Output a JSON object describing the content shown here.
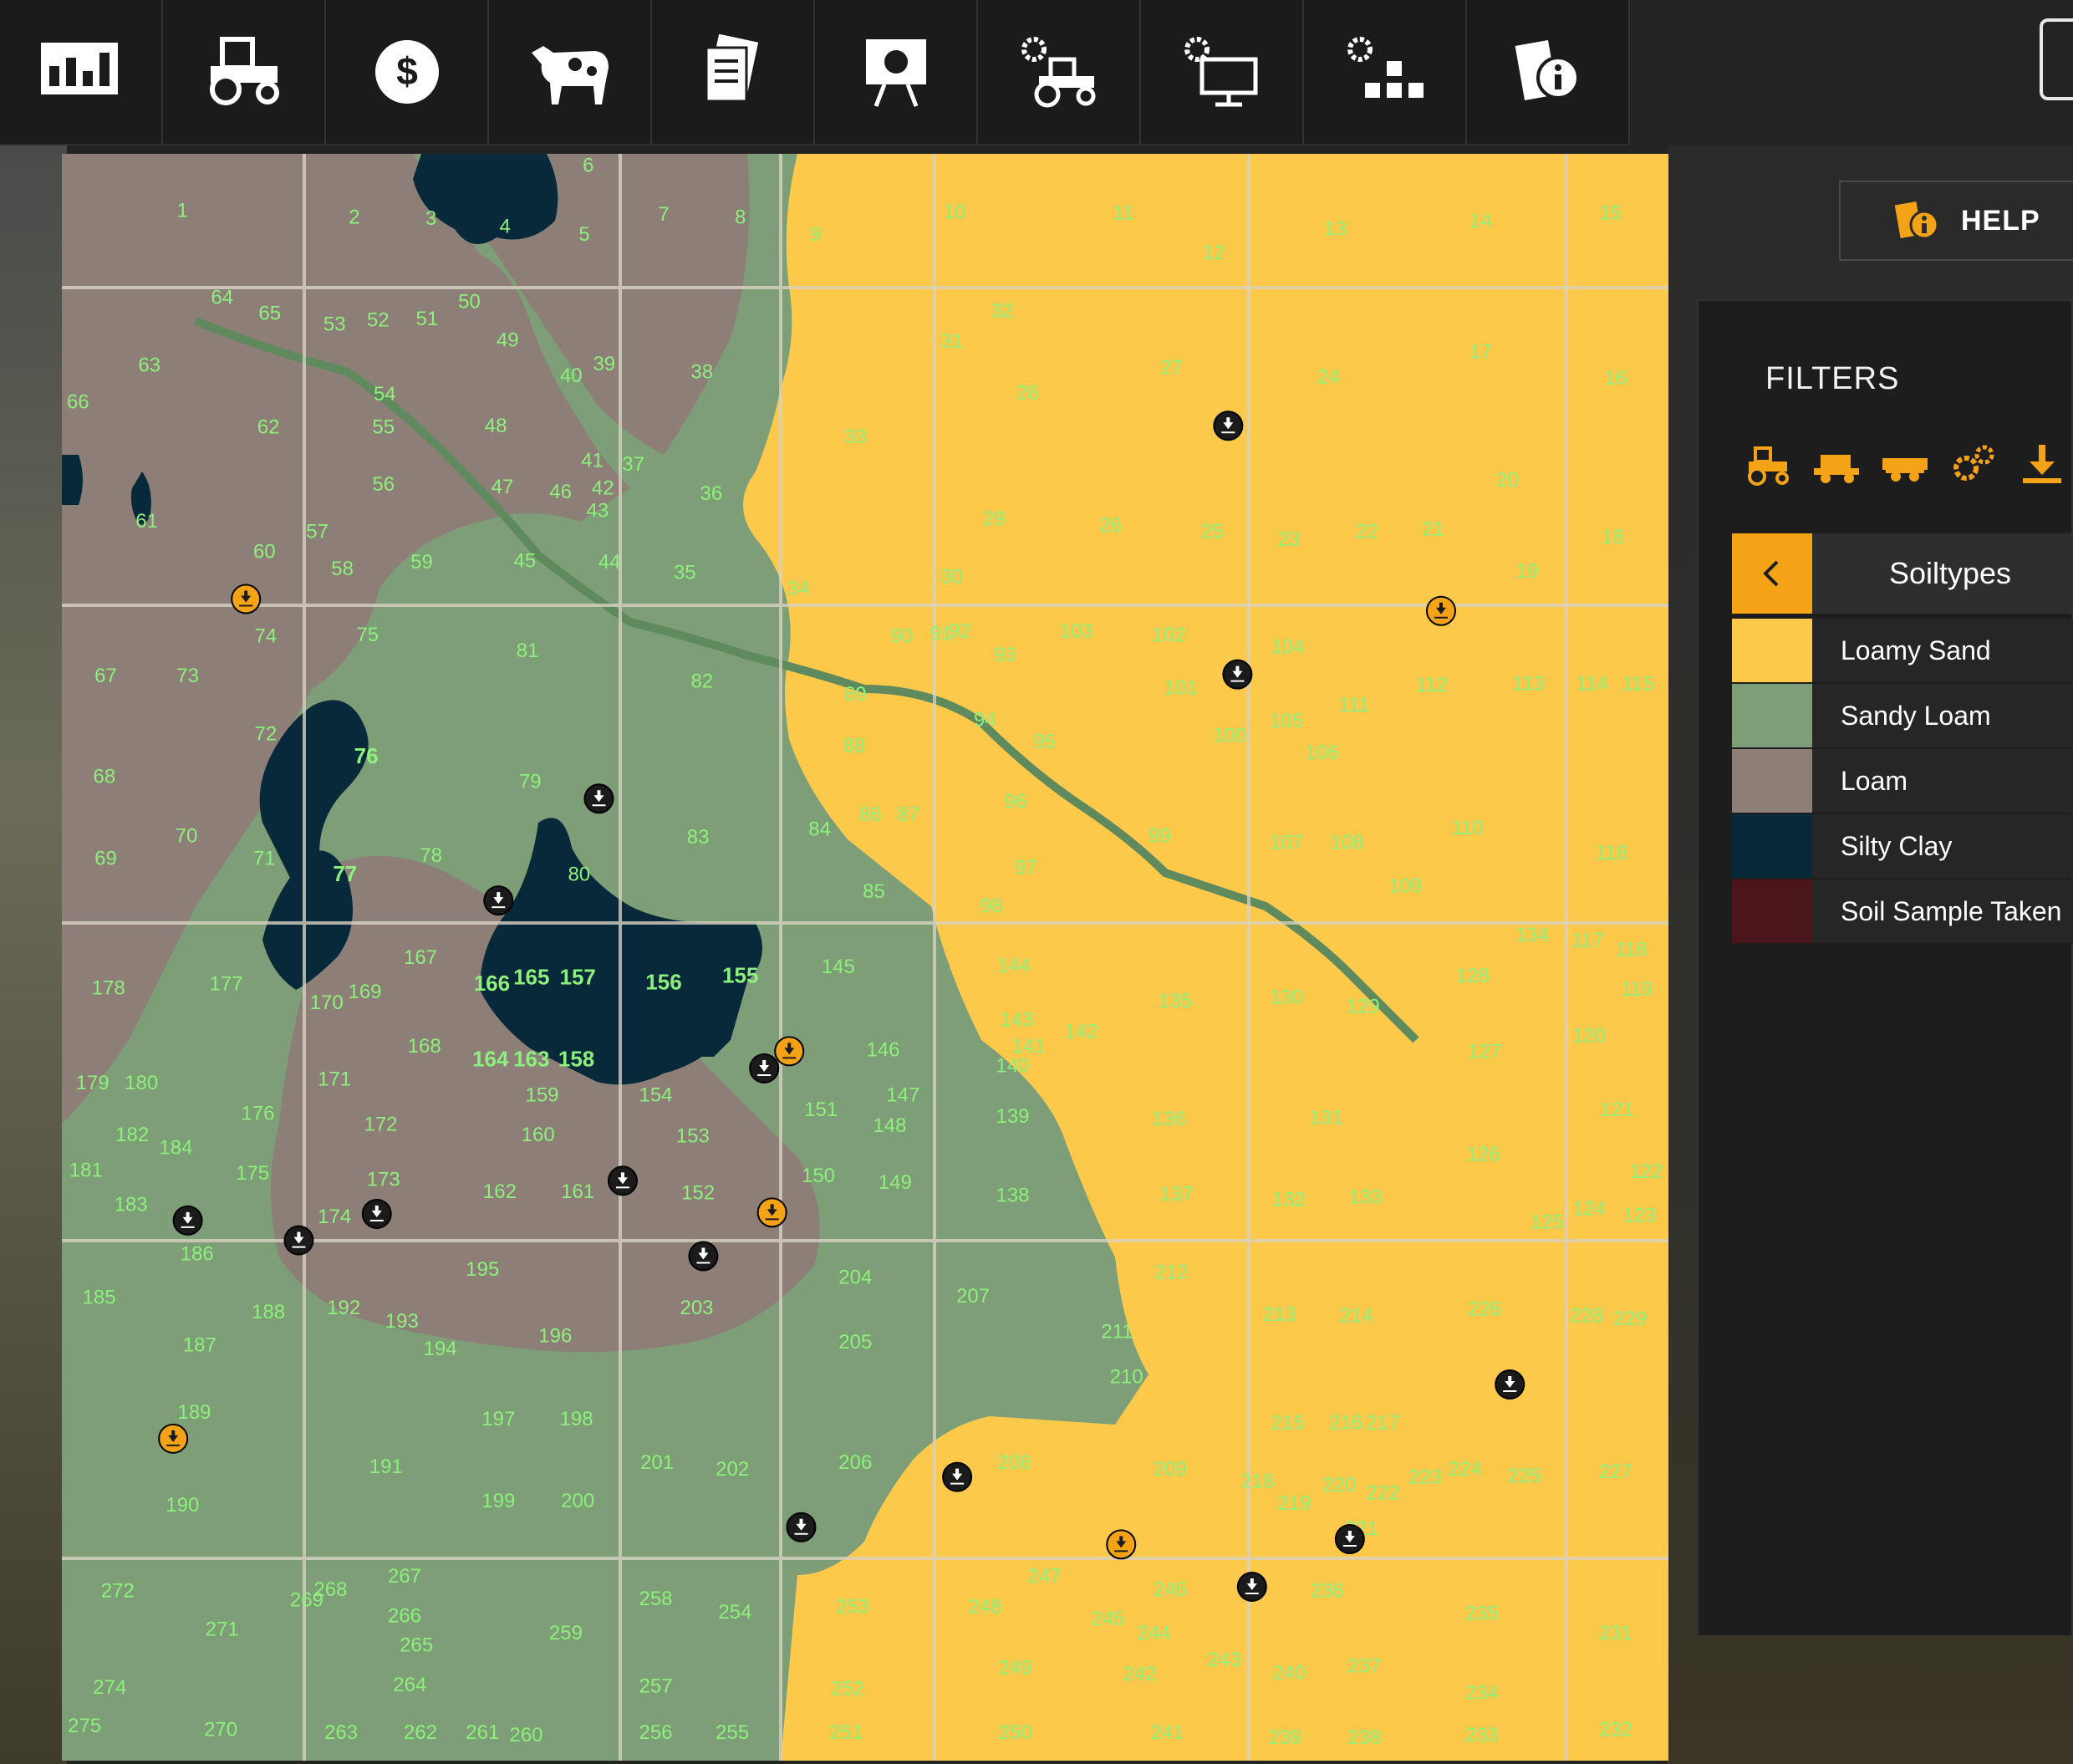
{
  "toolbar": {
    "tools": [
      {
        "icon": "stats-icon"
      },
      {
        "icon": "tractor-icon"
      },
      {
        "icon": "dollar-icon"
      },
      {
        "icon": "cow-icon"
      },
      {
        "icon": "contracts-icon"
      },
      {
        "icon": "presentation-icon"
      },
      {
        "icon": "vehicle-settings-icon"
      },
      {
        "icon": "monitor-settings-icon"
      },
      {
        "icon": "production-settings-icon"
      },
      {
        "icon": "info-icon"
      }
    ]
  },
  "help_button": {
    "label": "HELP",
    "icon": "help-icon"
  },
  "filters": {
    "title": "FILTERS",
    "icons": [
      "tractor-filter-icon",
      "harvester-filter-icon",
      "trailer-filter-icon",
      "gears-filter-icon",
      "unload-filter-icon"
    ],
    "accent": "#f5a316"
  },
  "soiltypes": {
    "title": "Soiltypes",
    "items": [
      {
        "label": "Loamy Sand",
        "color": "#fdc94b"
      },
      {
        "label": "Sandy Loam",
        "color": "#7d9e76"
      },
      {
        "label": "Loam",
        "color": "#8d7f78"
      },
      {
        "label": "Silty Clay",
        "color": "#072939"
      },
      {
        "label": "Soil Sample Taken",
        "color": "#4b151c"
      }
    ]
  },
  "field_labels": [
    "1",
    "2",
    "3",
    "4",
    "5",
    "6",
    "7",
    "8",
    "9",
    "10",
    "11",
    "12",
    "13",
    "14",
    "15",
    "16",
    "17",
    "18",
    "19",
    "20",
    "21",
    "22",
    "23",
    "24",
    "25",
    "26",
    "27",
    "28",
    "29",
    "30",
    "31",
    "32",
    "33",
    "34",
    "35",
    "36",
    "37",
    "38",
    "39",
    "40",
    "41",
    "42",
    "43",
    "44",
    "45",
    "46",
    "47",
    "48",
    "49",
    "50",
    "51",
    "52",
    "53",
    "54",
    "55",
    "56",
    "57",
    "58",
    "59",
    "60",
    "61",
    "62",
    "63",
    "64",
    "65",
    "66",
    "67",
    "68",
    "69",
    "70",
    "71",
    "72",
    "73",
    "74",
    "75",
    "76",
    "77",
    "78",
    "79",
    "80",
    "81",
    "82",
    "83",
    "84",
    "85",
    "86",
    "87",
    "88",
    "89",
    "90",
    "91",
    "92",
    "93",
    "94",
    "95",
    "96",
    "97",
    "98",
    "99",
    "100",
    "101",
    "102",
    "103",
    "104",
    "105",
    "106",
    "107",
    "108",
    "109",
    "110",
    "111",
    "112",
    "113",
    "114",
    "115",
    "116",
    "117",
    "118",
    "119",
    "120",
    "121",
    "122",
    "123",
    "124",
    "125",
    "126",
    "127",
    "128",
    "129",
    "130",
    "131",
    "132",
    "133",
    "134",
    "135",
    "136",
    "137",
    "138",
    "139",
    "140",
    "141",
    "142",
    "143",
    "144",
    "145",
    "146",
    "147",
    "148",
    "149",
    "150",
    "151",
    "152",
    "153",
    "154",
    "155",
    "156",
    "157",
    "158",
    "159",
    "160",
    "161",
    "162",
    "163",
    "164",
    "165",
    "166",
    "167",
    "168",
    "169",
    "170",
    "171",
    "172",
    "173",
    "174",
    "175",
    "176",
    "177",
    "178",
    "179",
    "180",
    "181",
    "182",
    "183",
    "184",
    "185",
    "186",
    "187",
    "188",
    "189",
    "190",
    "191",
    "192",
    "193",
    "194",
    "195",
    "196",
    "197",
    "198",
    "199",
    "200",
    "201",
    "202",
    "203",
    "204",
    "205",
    "206",
    "207",
    "208",
    "209",
    "210",
    "211",
    "212",
    "213",
    "214",
    "215",
    "216",
    "217",
    "218",
    "219",
    "220",
    "221",
    "222",
    "223",
    "224",
    "225",
    "226",
    "227",
    "228",
    "229",
    "231",
    "232",
    "233",
    "234",
    "235",
    "236",
    "237",
    "238",
    "239",
    "240",
    "241",
    "242",
    "243",
    "244",
    "245",
    "246",
    "247",
    "248",
    "249",
    "250",
    "251",
    "252",
    "253",
    "254",
    "255",
    "256",
    "257",
    "258",
    "259",
    "260",
    "261",
    "262",
    "263",
    "264",
    "265",
    "266",
    "267",
    "268",
    "269",
    "270",
    "271",
    "272",
    "274",
    "275"
  ]
}
